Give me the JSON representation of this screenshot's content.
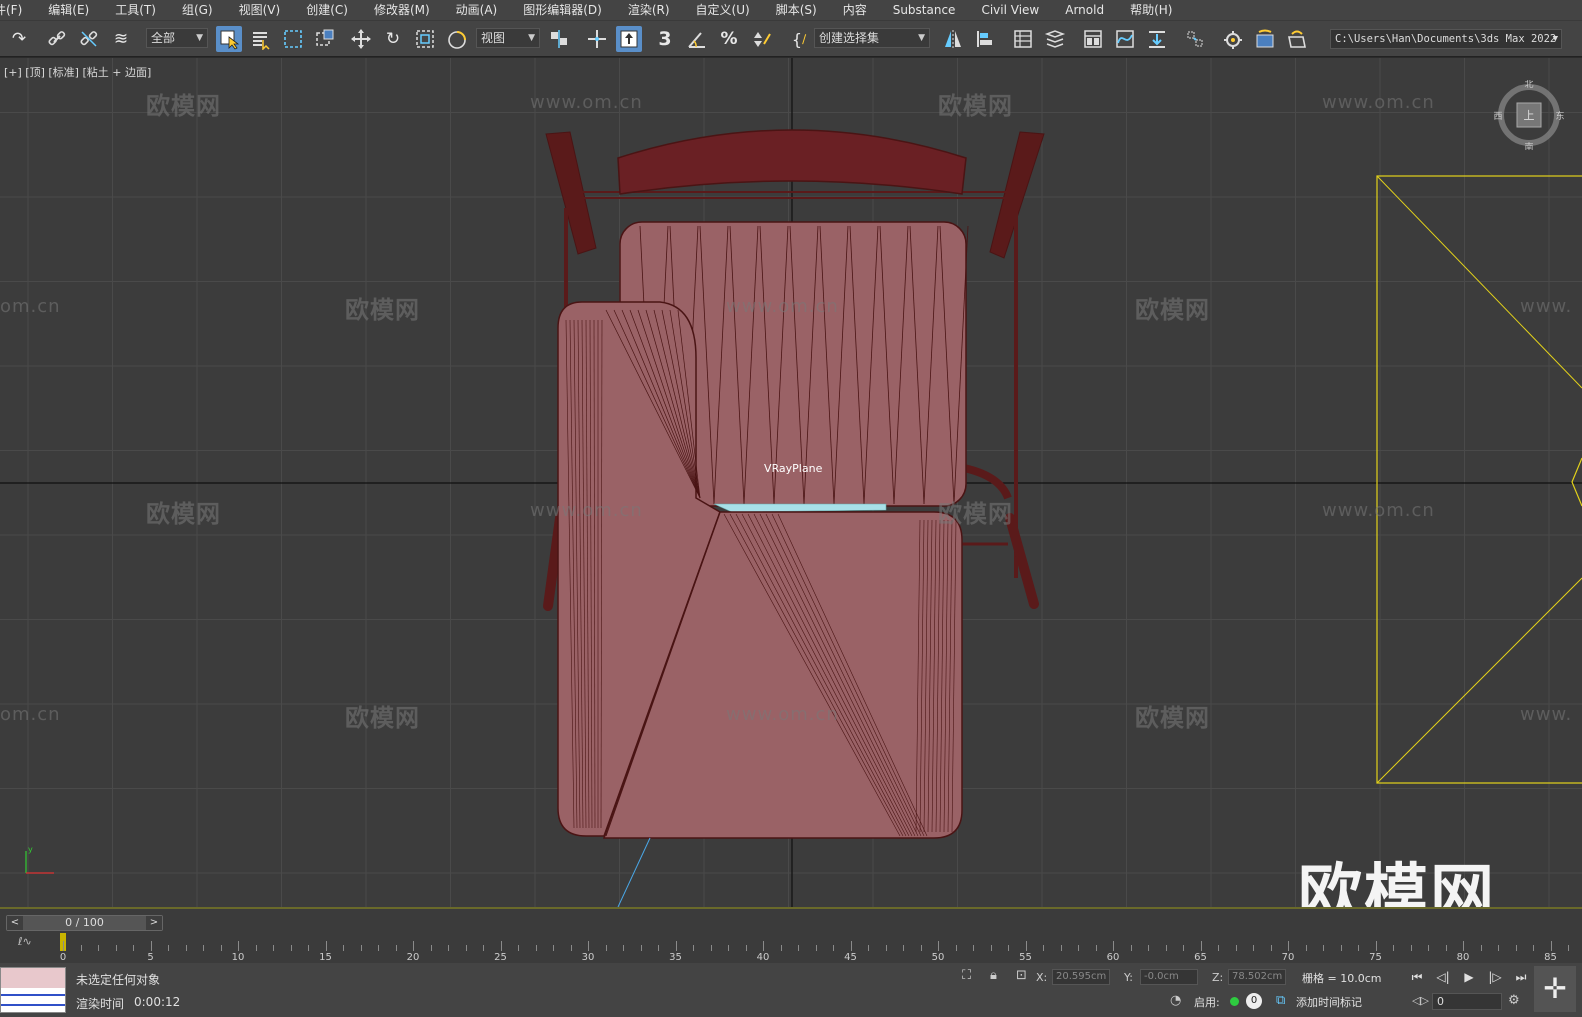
{
  "menu": [
    "件(F)",
    "编辑(E)",
    "工具(T)",
    "组(G)",
    "视图(V)",
    "创建(C)",
    "修改器(M)",
    "动画(A)",
    "图形编辑器(D)",
    "渲染(R)",
    "自定义(U)",
    "脚本(S)",
    "内容",
    "Substance",
    "Civil View",
    "Arnold",
    "帮助(H)"
  ],
  "toolbar": {
    "selection_filter": "全部",
    "ref_coord": "视图",
    "named_selection": "创建选择集",
    "project_path": "C:\\Users\\Han\\Documents\\3ds Max 2022",
    "snap_label": "3"
  },
  "viewport": {
    "label": "[+] [顶] [标准] [粘土 + 边面]",
    "object_label": "VRayPlane",
    "viewcube": {
      "n": "北",
      "s": "南",
      "w": "西",
      "e": "东",
      "face": "上"
    },
    "watermark_cn": "欧模网",
    "watermark_url": "www.om.cn",
    "watermark_partial_left": "om.cn",
    "watermark_partial_right": "www.",
    "watermark_big": "欧模网",
    "colors": {
      "background": "#3c3c3c",
      "grid_line": "#4a4a4a",
      "axis_line": "#101010",
      "model_face": "#9a6266",
      "model_edge": "#4a1414",
      "frame_dark": "#5a1a1a",
      "light_gizmo": "#e3d21a",
      "vrayplane": "#a8e0e8"
    }
  },
  "timeline": {
    "frame_range": "0 / 100",
    "tick_labels": [
      "0",
      "5",
      "10",
      "15",
      "20",
      "25",
      "30",
      "35",
      "40",
      "45",
      "50",
      "55",
      "60",
      "65",
      "70",
      "75",
      "80",
      "85"
    ]
  },
  "status": {
    "selection": "未选定任何对象",
    "render_time_label": "渲染时间",
    "render_time": "0:00:12",
    "x_label": "X:",
    "x_value": "20.595cm",
    "y_label": "Y:",
    "y_value": "-0.0cm",
    "z_label": "Z:",
    "z_value": "78.502cm",
    "grid": "栅格 = 10.0cm",
    "enable": "启用:",
    "enable_count": "0",
    "add_time_tag": "添加时间标记",
    "current_frame": "0"
  }
}
